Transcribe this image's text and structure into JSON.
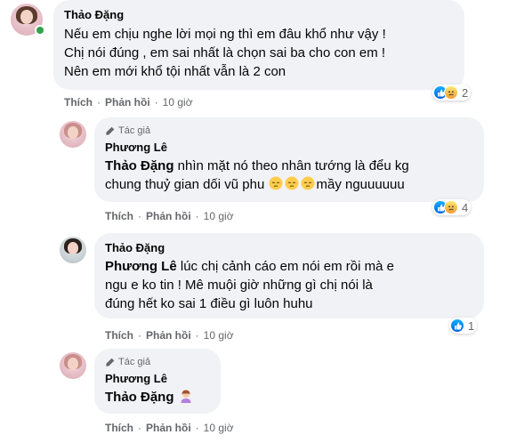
{
  "comments": [
    {
      "author": "Thảo Đặng",
      "lines": [
        "Nếu em chịu nghe lời mọi ng thì em đâu khổ như vậy !",
        "Chị nói đúng , em sai nhất là chọn sai ba cho con em !",
        "Nên em mới khổ tội nhất vẫn là 2 con"
      ],
      "like_label": "Thích",
      "reply_label": "Phản hồi",
      "time": "10 giờ",
      "reaction_count": "2"
    },
    {
      "badge": "Tác giả",
      "author": "Phương Lê",
      "mention": "Thảo Đặng",
      "line1_rest": " nhìn mặt nó theo nhân tướng là đểu kg",
      "line2": "chung thuỷ gian dối vũ phu ",
      "line2_tail": "mầy nguuuuuu",
      "like_label": "Thích",
      "reply_label": "Phản hồi",
      "time": "10 giờ",
      "reaction_count": "4"
    },
    {
      "author": "Thảo Đặng",
      "mention": "Phương Lê",
      "line1_rest": " lúc chị cảnh cáo em nói em rồi mà e",
      "line2": "ngu e ko tin ! Mê muội giờ những gì chị nói là",
      "line3": "đúng hết ko sai 1 điều gì luôn huhu",
      "like_label": "Thích",
      "reply_label": "Phản hồi",
      "time": "10 giờ",
      "reaction_count": "1"
    },
    {
      "badge": "Tác giả",
      "author": "Phương Lê",
      "mention": "Thảo Đặng",
      "like_label": "Thích",
      "reply_label": "Phản hồi",
      "time": "10 giờ"
    }
  ],
  "icons": {
    "like": "like-reaction-icon",
    "sad": "sad-reaction-icon",
    "author_badge": "pen-icon",
    "emoji": "pensive-face-emoji",
    "gesture": "woman-gesturing-emoji"
  },
  "colors": {
    "bubble": "#f0f2f5",
    "meta_text": "#65676b",
    "like_blue": "#1877f2",
    "online": "#31a24c"
  }
}
